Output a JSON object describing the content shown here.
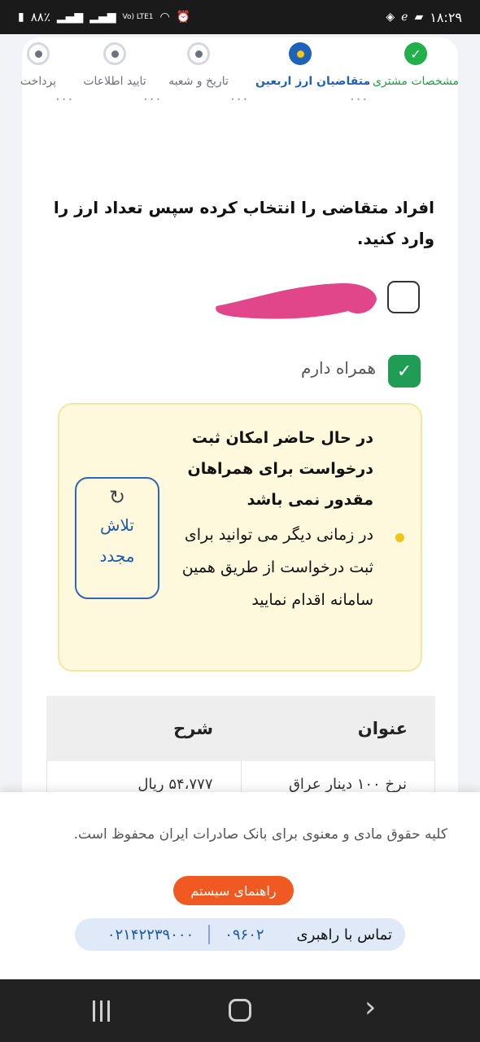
{
  "status_bar": {
    "time": "۱۸:۲۹",
    "battery": "۸۸٪",
    "network": "Vo) LTE1"
  },
  "stepper": {
    "steps": [
      {
        "label": "مشخصات مشتری",
        "state": "done"
      },
      {
        "label": "متقاضیان ارز اربعین",
        "state": "active"
      },
      {
        "label": "تاریخ و شعبه",
        "state": "idle"
      },
      {
        "label": "تایید اطلاعات",
        "state": "idle"
      },
      {
        "label": "پرداخت",
        "state": "idle"
      }
    ],
    "separator": "..."
  },
  "instruction": "افراد متقاضی را انتخاب کرده سپس تعداد ارز را وارد کنید.",
  "applicants": {
    "companion_label": "همراه دارم",
    "first_checked": false,
    "companion_checked": true
  },
  "notice": {
    "title": "در حال حاضر امکان ثبت درخواست برای همراهان مقدور نمی باشد",
    "body": "در زمانی دیگر می توانید برای ثبت درخواست از طریق همین سامانه اقدام نمایید",
    "retry_label": "تلاش مجدد",
    "retry_icon": "↻"
  },
  "table": {
    "headers": [
      "عنوان",
      "شرح"
    ],
    "rows": [
      [
        "نرخ ۱۰۰ دینار عراق",
        "۵۴،۷۷۷ ریال"
      ]
    ]
  },
  "footer": {
    "copyright": "کلیه حقوق مادی و معنوی برای بانک صادرات ایران محفوظ است.",
    "guide_button": "راهنمای سیستم",
    "contact_label": "تماس با راهبری",
    "contact_numbers": [
      "۰۹۶۰۲",
      "۰۲۱۴۲۲۳۹۰۰۰"
    ]
  },
  "colors": {
    "done": "#22b04b",
    "active": "#1e63b8",
    "notice_bg": "#fef9dd",
    "guide_button": "#f05a22"
  }
}
